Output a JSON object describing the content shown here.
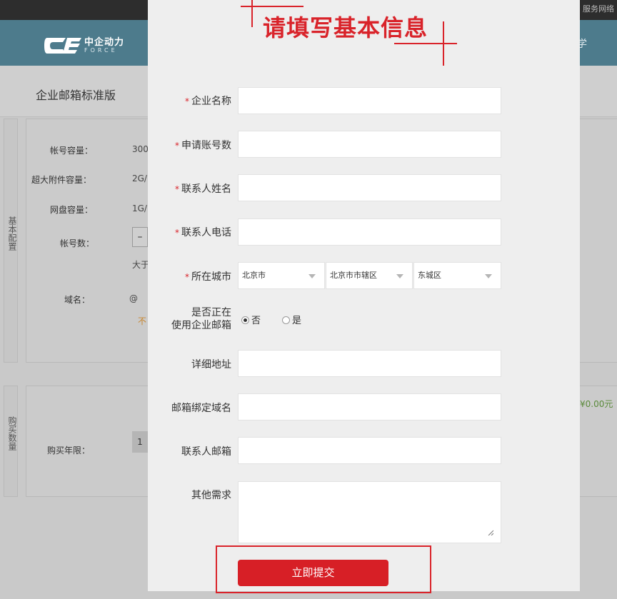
{
  "background": {
    "topbar_link": "服务网络",
    "logo": {
      "cn": "中企动力",
      "en": "FORCE"
    },
    "nav_right": "学",
    "page_title": "企业邮箱标准版",
    "config_panel": {
      "side_label": "基本配置",
      "rows": [
        {
          "label": "帐号容量：",
          "value": "300"
        },
        {
          "label": "超大附件容量：",
          "value": "2G/"
        },
        {
          "label": "网盘容量：",
          "value": "1G/"
        },
        {
          "label": "帐号数：",
          "value": "–"
        },
        {
          "label": "",
          "value": "大于"
        },
        {
          "label": "域名：",
          "value": "@"
        },
        {
          "label": "",
          "value": "不"
        }
      ]
    },
    "purchase_panel": {
      "side_label": "购买数量",
      "year_label": "购买年限：",
      "year_value": "1"
    },
    "price": "¥0.00元"
  },
  "modal": {
    "title": "请填写基本信息",
    "fields": {
      "company_name": {
        "label": "企业名称",
        "value": ""
      },
      "account_count": {
        "label": "申请账号数",
        "value": ""
      },
      "contact_name": {
        "label": "联系人姓名",
        "value": ""
      },
      "contact_phone": {
        "label": "联系人电话",
        "value": ""
      },
      "city": {
        "label": "所在城市",
        "province": "北京市",
        "district": "北京市市辖区",
        "county": "东城区"
      },
      "using_email": {
        "label_line1": "是否正在",
        "label_line2": "使用企业邮箱",
        "options": [
          "否",
          "是"
        ],
        "selected": "否"
      },
      "address": {
        "label": "详细地址",
        "value": ""
      },
      "bound_domain": {
        "label": "邮箱绑定域名",
        "value": ""
      },
      "contact_email": {
        "label": "联系人邮箱",
        "value": ""
      },
      "other_needs": {
        "label": "其他需求",
        "value": ""
      }
    },
    "submit_label": "立即提交"
  },
  "colors": {
    "accent_red": "#d9232a",
    "header_teal": "#4d7b8c"
  }
}
